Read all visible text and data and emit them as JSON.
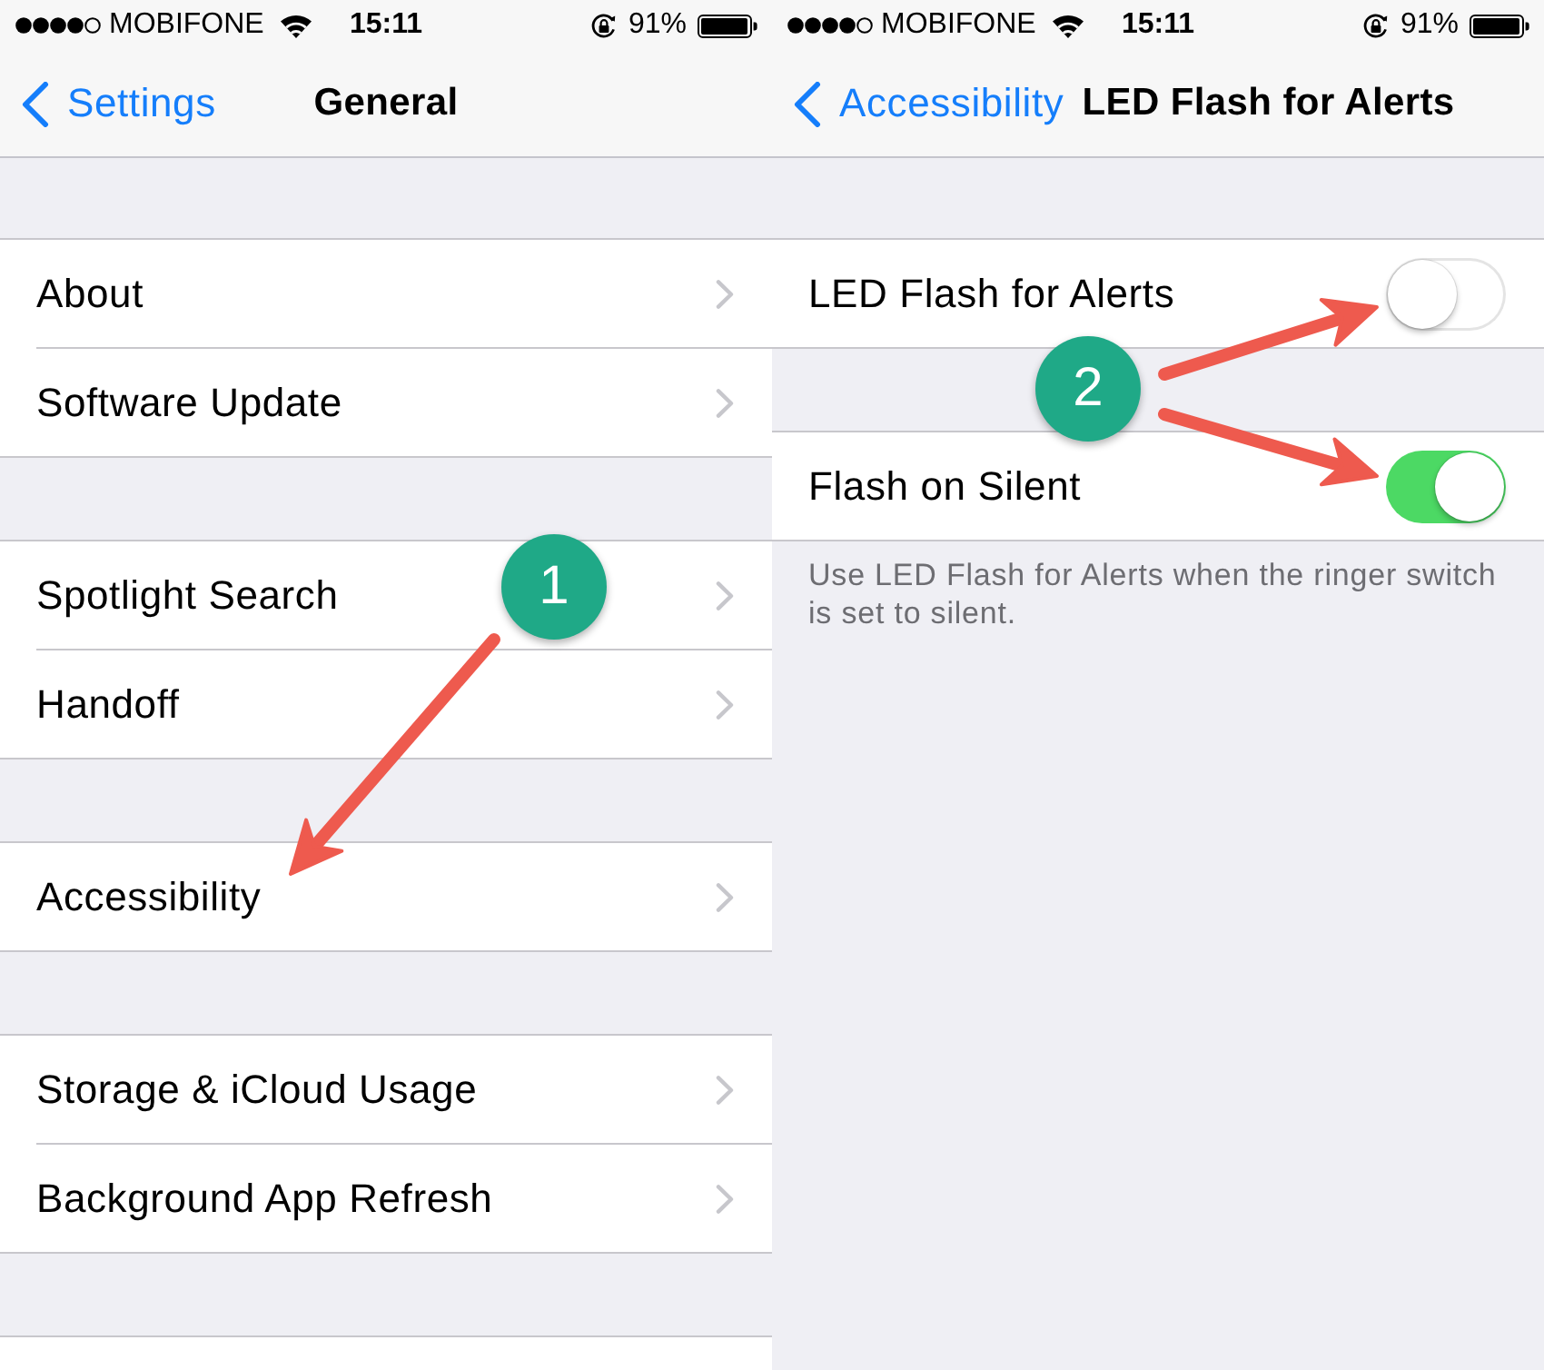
{
  "panels": [
    {
      "status_bar": {
        "carrier": "MOBIFONE",
        "time": "15:11",
        "battery": "91%"
      },
      "nav_bar": {
        "back": "Settings",
        "title": "General"
      },
      "groups": [
        {
          "rows": [
            {
              "kind": "link",
              "label": "About"
            },
            {
              "kind": "link",
              "label": "Software Update"
            }
          ]
        },
        {
          "rows": [
            {
              "kind": "link",
              "label": "Spotlight Search"
            },
            {
              "kind": "link",
              "label": "Handoff"
            }
          ]
        },
        {
          "rows": [
            {
              "kind": "link",
              "label": "Accessibility"
            }
          ]
        },
        {
          "rows": [
            {
              "kind": "link",
              "label": "Storage & iCloud Usage"
            },
            {
              "kind": "link",
              "label": "Background App Refresh"
            }
          ]
        }
      ]
    },
    {
      "status_bar": {
        "carrier": "MOBIFONE",
        "time": "15:11",
        "battery": "91%"
      },
      "nav_bar": {
        "back": "Accessibility",
        "title": "LED Flash for Alerts"
      },
      "groups": [
        {
          "rows": [
            {
              "kind": "switch",
              "label": "LED Flash for Alerts",
              "on": false
            }
          ]
        },
        {
          "rows": [
            {
              "kind": "switch",
              "label": "Flash on Silent",
              "on": true
            }
          ],
          "footer": "Use LED Flash for Alerts when the ringer switch is set to silent."
        }
      ]
    }
  ],
  "annotations": [
    {
      "number": "1"
    },
    {
      "number": "2"
    }
  ]
}
